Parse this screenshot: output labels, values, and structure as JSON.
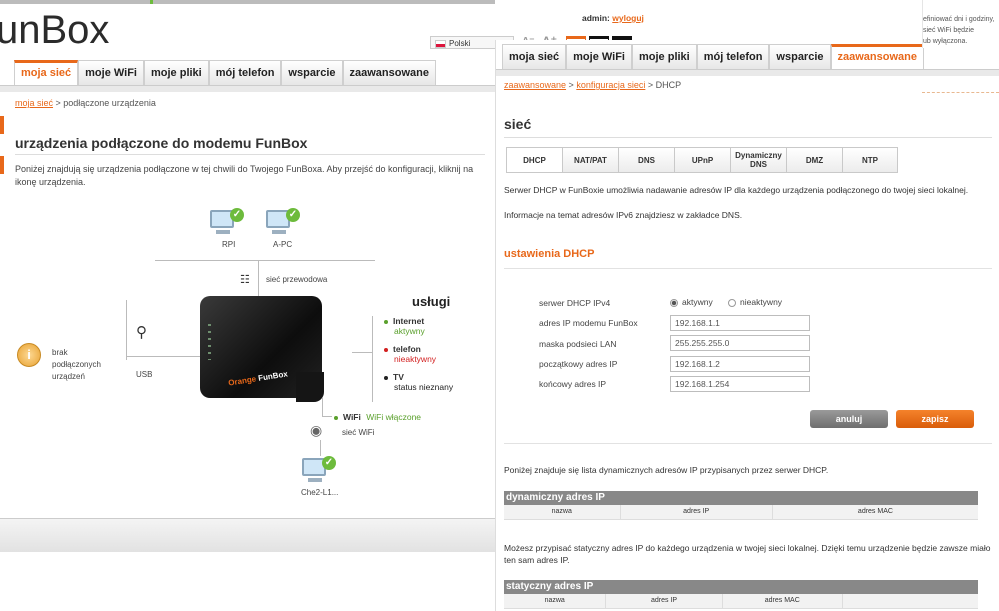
{
  "left": {
    "brand": "unBox",
    "nav": [
      "moja sieć",
      "moje WiFi",
      "moje pliki",
      "mój telefon",
      "wsparcie",
      "zaawansowane"
    ],
    "breadcrumb_link": "moja sieć",
    "breadcrumb_rest": " > podłączone urządzenia",
    "title": "urządzenia podłączone do modemu FunBox",
    "intro": "Poniżej znajdują się urządzenia podłączone w tej chwili do Twojego FunBoxa. Aby przejść do konfiguracji, kliknij na ikonę urządzenia.",
    "devices": [
      "RPI",
      "A-PC",
      "Che2-L1..."
    ],
    "wired_label": "sieć przewodowa",
    "usb_label": "USB",
    "info_text": [
      "brak",
      "podłączonych",
      "urządzeń"
    ],
    "services_title": "usługi",
    "services": [
      {
        "name": "Internet",
        "status": "aktywny",
        "color": "#5aa02c"
      },
      {
        "name": "telefon",
        "status": "nieaktywny",
        "color": "#d21f1f"
      },
      {
        "name": "TV",
        "status": "status nieznany",
        "color": "#222222"
      }
    ],
    "wifi_name": "WiFi",
    "wifi_status": "WiFi włączone",
    "wifi_network": "sieć WiFi",
    "router_brand_orange": "Orange",
    "router_brand": "FunBox"
  },
  "top": {
    "admin_label": "admin:",
    "logout": "wyloguj",
    "language": "Polski"
  },
  "right": {
    "nav": [
      "moja sieć",
      "moje WiFi",
      "moje pliki",
      "mój telefon",
      "wsparcie",
      "zaawansowane"
    ],
    "breadcrumb_link1": "zaawansowane",
    "breadcrumb_link2": "konfiguracja sieci",
    "breadcrumb_rest": " > DHCP",
    "title": "sieć",
    "subtabs": [
      "DHCP",
      "NAT/PAT",
      "DNS",
      "UPnP",
      "Dynamiczny DNS",
      "DMZ",
      "NTP"
    ],
    "desc1": "Serwer DHCP w FunBoxie umożliwia nadawanie adresów IP dla każdego urządzenia podłączonego do twojej sieci lokalnej.",
    "desc2": "Informacje na temat adresów IPv6 znajdziesz w zakładce DNS.",
    "section_title": "ustawienia DHCP",
    "fields": {
      "server_label": "serwer DHCP IPv4",
      "active": "aktywny",
      "inactive": "nieaktywny",
      "ip_label": "adres IP modemu FunBox",
      "ip_value": "192.168.1.1",
      "mask_label": "maska podsieci LAN",
      "mask_value": "255.255.255.0",
      "start_label": "początkowy adres IP",
      "start_value": "192.168.1.2",
      "end_label": "końcowy adres IP",
      "end_value": "192.168.1.254"
    },
    "cancel": "anuluj",
    "save": "zapisz",
    "dyn_intro": "Poniżej znajduje się lista dynamicznych adresów IP przypisanych przez serwer DHCP.",
    "dyn_title": "dynamiczny adres IP",
    "cols": [
      "nazwa",
      "adres IP",
      "adres MAC"
    ],
    "static_intro": "Możesz przypisać statyczny adres IP do każdego urządzenia w twojej sieci lokalnej. Dzięki temu urządzenie będzie zawsze miało ten sam adres IP.",
    "static_title": "statyczny adres IP"
  },
  "topright": {
    "lines": [
      "efiniować dni i godziny,",
      "sieć WiFi będzie",
      "ub wyłączona."
    ]
  }
}
